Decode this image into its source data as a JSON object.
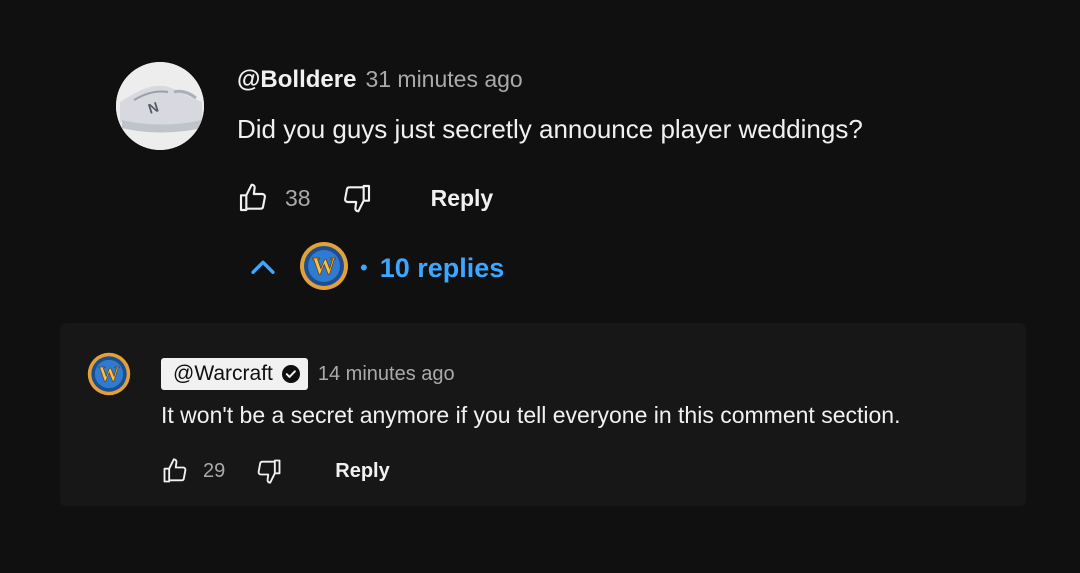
{
  "comment": {
    "author": "@Bolldere",
    "time": "31 minutes ago",
    "text": "Did you guys just secretly announce player weddings?",
    "likes": "38",
    "reply_label": "Reply",
    "avatar_icon": "sneaker-avatar",
    "replies_dot": "•",
    "replies_label": "10 replies"
  },
  "reply": {
    "channel": "@Warcraft",
    "verified_icon": "verified-check-icon",
    "time": "14 minutes ago",
    "text": "It won't be a secret anymore if you tell everyone in this comment section.",
    "likes": "29",
    "reply_label": "Reply",
    "avatar_icon": "warcraft-logo-avatar"
  },
  "colors": {
    "background": "#101010",
    "card": "#171717",
    "link_blue": "#3ea6ff",
    "secondary_text": "#aaaaaa"
  }
}
